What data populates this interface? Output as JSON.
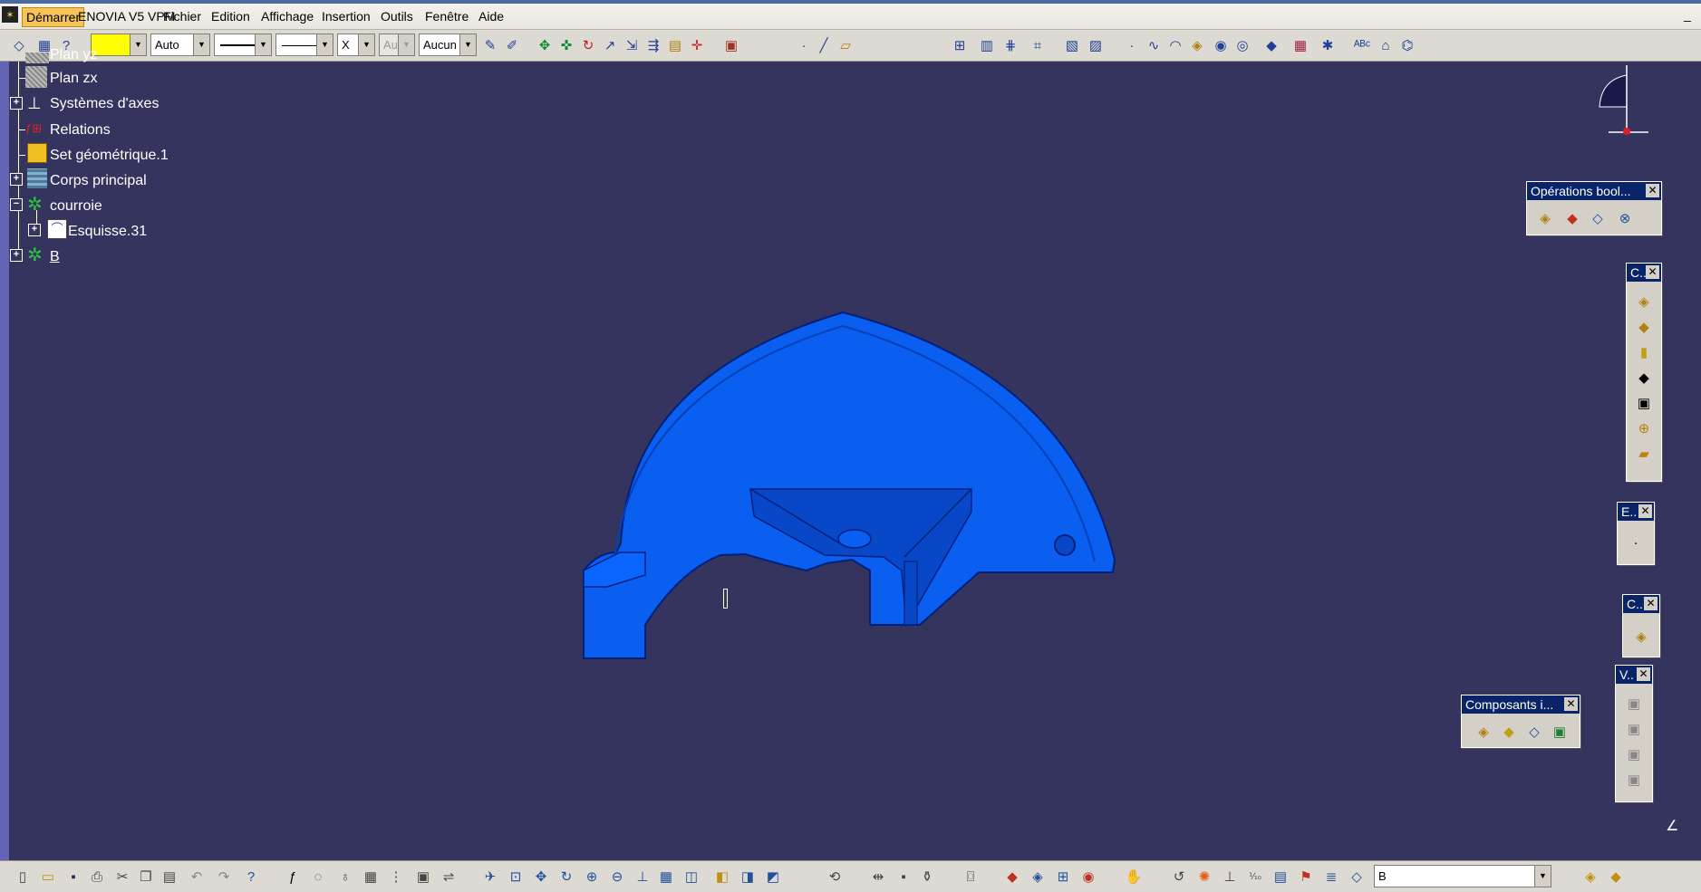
{
  "menubar": {
    "items": [
      "Démarrer",
      "ENOVIA V5 VPM",
      "Fichier",
      "Edition",
      "Affichage",
      "Insertion",
      "Outils",
      "Fenêtre",
      "Aide"
    ]
  },
  "toolbar_top": {
    "color_combo": "",
    "line_type_combo": "Auto",
    "point_combo": "X",
    "layer_combo": "Auti",
    "rendering_combo": "Aucun"
  },
  "tree": {
    "items": [
      "Plan yz",
      "Plan zx",
      "Systèmes d'axes",
      "Relations",
      "Set géométrique.1",
      "Corps principal",
      "courroie",
      "Esquisse.31",
      "B"
    ]
  },
  "panels": {
    "boolean_ops": "Opérations bool...",
    "c_panel_1": "C..",
    "e_panel": "E..",
    "c_panel_2": "C..",
    "v_panel": "V..",
    "composants": "Composants i..."
  },
  "bottom_toolbar": {
    "command_input": "B"
  },
  "colors": {
    "viewport": "#34345f",
    "part": "#0a5ef0",
    "part_dark": "#0540b8"
  }
}
